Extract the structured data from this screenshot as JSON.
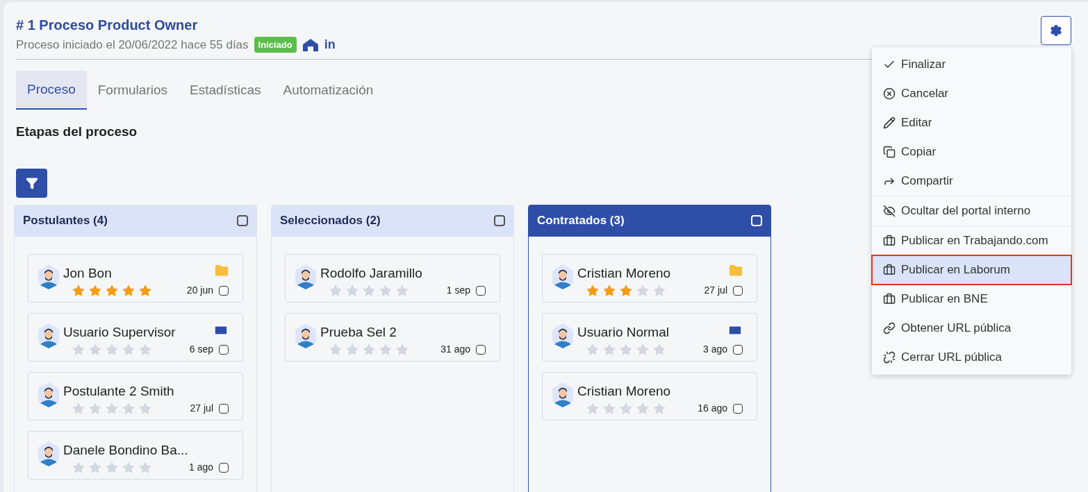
{
  "header": {
    "title": "# 1 Proceso Product Owner",
    "subtitle": "Proceso iniciado el 20/06/2022 hace 55 días",
    "status": "Iniciado",
    "linkedin": "in"
  },
  "tabs": [
    {
      "label": "Proceso",
      "selected": true
    },
    {
      "label": "Formularios",
      "selected": false
    },
    {
      "label": "Estadísticas",
      "selected": false
    },
    {
      "label": "Automatización",
      "selected": false
    }
  ],
  "section_title": "Etapas del proceso",
  "columns": [
    {
      "title": "Postulantes (4)",
      "selected": false,
      "checked": false,
      "cards": [
        {
          "name": "Jon Bon",
          "stars": 5,
          "date": "20 jun",
          "checked": false,
          "kind": "folder"
        },
        {
          "name": "Usuario Supervisor",
          "stars": 0,
          "date": "6 sep",
          "checked": false,
          "kind": "badge"
        },
        {
          "name": "Postulante 2 Smith",
          "stars": 0,
          "date": "27 jul",
          "checked": false,
          "kind": "plain"
        },
        {
          "name": "Danele Bondino Ba...",
          "stars": 0,
          "date": "1 ago",
          "checked": false,
          "kind": "plain"
        }
      ]
    },
    {
      "title": "Seleccionados (2)",
      "selected": false,
      "checked": false,
      "cards": [
        {
          "name": "Rodolfo Jaramillo",
          "stars": 0,
          "date": "1 sep",
          "checked": false,
          "kind": "plain"
        },
        {
          "name": "Prueba Sel 2",
          "stars": 0,
          "date": "31 ago",
          "checked": false,
          "kind": "plain"
        }
      ]
    },
    {
      "title": "Contratados (3)",
      "selected": true,
      "checked": false,
      "cards": [
        {
          "name": "Cristian Moreno",
          "stars": 3,
          "date": "27 jul",
          "checked": false,
          "kind": "folder"
        },
        {
          "name": "Usuario Normal",
          "stars": 0,
          "date": "3 ago",
          "checked": false,
          "kind": "badge"
        },
        {
          "name": "Cristian Moreno",
          "stars": 0,
          "date": "16 ago",
          "checked": false,
          "kind": "plain"
        }
      ]
    }
  ],
  "menu": {
    "groups": [
      [
        {
          "label": "Finalizar",
          "kind": "check",
          "selected": false
        },
        {
          "label": "Cancelar",
          "kind": "cancel",
          "selected": false
        },
        {
          "label": "Editar",
          "kind": "pencil",
          "selected": false
        },
        {
          "label": "Copiar",
          "kind": "copy",
          "selected": false
        },
        {
          "label": "Compartir",
          "kind": "share",
          "selected": false
        }
      ],
      [
        {
          "label": "Ocultar del portal interno",
          "kind": "hide",
          "selected": false
        }
      ],
      [
        {
          "label": "Publicar en Trabajando.com",
          "kind": "publish",
          "selected": false
        },
        {
          "label": "Publicar en Laborum",
          "kind": "publish",
          "selected": true
        },
        {
          "label": "Publicar en BNE",
          "kind": "publish",
          "selected": false
        },
        {
          "label": "Obtener URL pública",
          "kind": "link",
          "selected": false
        },
        {
          "label": "Cerrar URL pública",
          "kind": "unlink",
          "selected": false
        }
      ]
    ]
  }
}
